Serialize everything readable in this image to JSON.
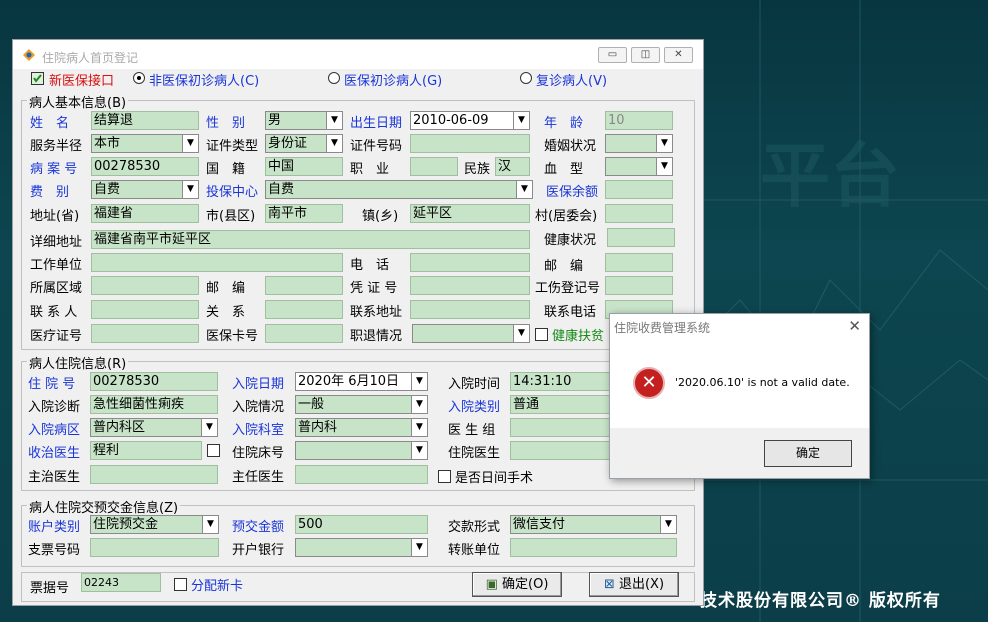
{
  "background": {
    "copyright": "技术股份有限公司® 版权所有"
  },
  "window": {
    "title": "住院病人首页登记",
    "controls": {
      "minimize": "▭",
      "restore": "◫",
      "close": "✕"
    }
  },
  "toprow": {
    "new_insurance_label": "新医保接口",
    "radio_non_insurance": "非医保初诊病人(C)",
    "radio_insurance": "医保初诊病人(G)",
    "radio_revisit": "复诊病人(V)",
    "selected": "非医保初诊病人(C)"
  },
  "basic": {
    "group_title": "病人基本信息(B)",
    "name_label": "姓　名",
    "name": "结算退",
    "gender_label": "性　别",
    "gender": "男",
    "birth_label": "出生日期",
    "birth": "2010-06-09",
    "age_label": "年　龄",
    "age": "10",
    "service_radius_label": "服务半径",
    "service_radius": "本市",
    "id_type_label": "证件类型",
    "id_type": "身份证",
    "id_number_label": "证件号码",
    "id_number": "",
    "marital_label": "婚姻状况",
    "marital": "",
    "record_no_label": "病 案 号",
    "record_no": "00278530",
    "nationality_label": "国　籍",
    "nationality": "中国",
    "occupation_label": "职　业",
    "occupation": "",
    "ethnicity_label": "民族",
    "ethnicity": "汉",
    "blood_label": "血　型",
    "blood": "",
    "fee_type_label": "费　别",
    "fee_type": "自费",
    "insurance_center_label": "投保中心",
    "insurance_center": "自费",
    "insurance_balance_label": "医保余额",
    "insurance_balance": "",
    "province_label": "地址(省)",
    "province": "福建省",
    "city_label": "市(县区)",
    "city": "南平市",
    "town_label": "镇(乡)",
    "town": "延平区",
    "village_label": "村(居委会)",
    "village": "",
    "address_label": "详细地址",
    "address": "福建省南平市延平区",
    "health_label": "健康状况",
    "health": "",
    "workplace_label": "工作单位",
    "workplace": "",
    "phone_label": "电　话",
    "phone": "",
    "postcode_label": "邮　编",
    "postcode": "",
    "area_label": "所属区域",
    "area": "",
    "postcode2_label": "邮　编",
    "postcode2": "",
    "cert_no_label": "凭 证 号",
    "cert_no": "",
    "injury_reg_label": "工伤登记号",
    "injury_reg": "",
    "contact_label": "联 系 人",
    "contact": "",
    "relation_label": "关　系",
    "relation": "",
    "contact_addr_label": "联系地址",
    "contact_addr": "",
    "contact_phone_label": "联系电话",
    "contact_phone": "",
    "medical_cert_label": "医疗证号",
    "medical_cert": "",
    "insurance_card_label": "医保卡号",
    "insurance_card": "",
    "retire_label": "职退情况",
    "retire": "",
    "poverty_label": "健康扶贫"
  },
  "admission": {
    "group_title": "病人住院信息(R)",
    "inpatient_no_label": "住 院 号",
    "inpatient_no": "00278530",
    "admit_date_label": "入院日期",
    "admit_date": "2020年 6月10日",
    "admit_time_label": "入院时间",
    "admit_time": "14:31:10",
    "diagnosis_label": "入院诊断",
    "diagnosis": "急性细菌性痢疾",
    "condition_label": "入院情况",
    "condition": "一般",
    "category_label": "入院类别",
    "category": "普通",
    "ward_label": "入院病区",
    "ward": "普内科区",
    "dept_label": "入院科室",
    "dept": "普内科",
    "med_group_label": "医 生 组",
    "med_group": "",
    "admit_doctor_label": "收治医生",
    "admit_doctor": "程利",
    "bed_label": "住院床号",
    "bed": "",
    "inpatient_doctor_label": "住院医生",
    "inpatient_doctor": "",
    "attending_label": "主治医生",
    "attending": "",
    "chief_label": "主任医生",
    "chief": "",
    "day_surgery_label": "是否日间手术"
  },
  "deposit": {
    "group_title": "病人住院交预交金信息(Z)",
    "account_type_label": "账户类别",
    "account_type": "住院预交金",
    "amount_label": "预交金额",
    "amount": "500",
    "pay_method_label": "交款形式",
    "pay_method": "微信支付",
    "check_no_label": "支票号码",
    "check_no": "",
    "bank_label": "开户银行",
    "bank": "",
    "transfer_unit_label": "转账单位",
    "transfer_unit": ""
  },
  "footer": {
    "receipt_label": "票据号",
    "receipt": "02243",
    "new_card_label": "分配新卡",
    "ok_label": "确定(O)",
    "exit_label": "退出(X)"
  },
  "dialog": {
    "title": "住院收费管理系统",
    "message": "'2020.06.10' is not a valid date.",
    "ok_label": "确定",
    "close": "✕",
    "icon": "✕"
  }
}
